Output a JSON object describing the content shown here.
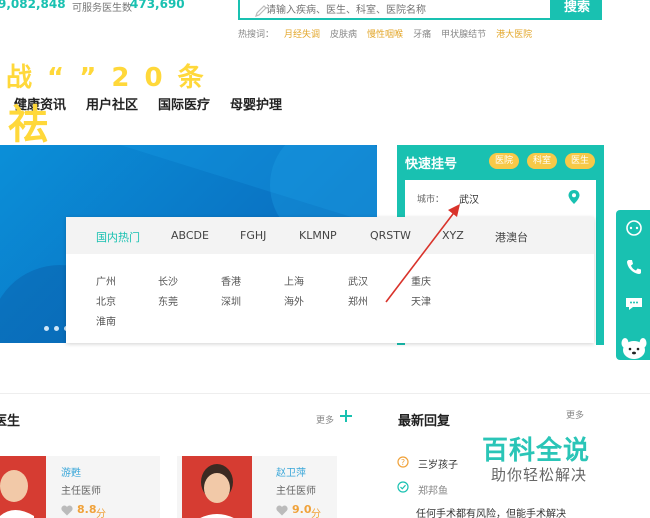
{
  "stats": {
    "visits_num": "9,082,848",
    "doctors_label": "可服务医生数",
    "doctors_num": "473,690"
  },
  "search": {
    "placeholder": "请输入疾病、医生、科室、医院名称",
    "button": "搜索",
    "hot_label": "热搜词：",
    "hot_words": [
      "月经失调",
      "皮肤病",
      "慢性咽喉",
      "牙痛",
      "甲状腺结节",
      "港大医院"
    ]
  },
  "nav": {
    "items": [
      "健康资讯",
      "用户社区",
      "国际医疗",
      "母婴护理"
    ]
  },
  "banner": {
    "text_top": "战 “ ” 2 0 条",
    "text_big": "祛"
  },
  "quick": {
    "title": "快速挂号",
    "tags": [
      "医院",
      "科室",
      "医生"
    ],
    "city_label": "城市：",
    "city_value": "武汉"
  },
  "dropdown": {
    "tabs": [
      "国内热门",
      "ABCDE",
      "FGHJ",
      "KLMNP",
      "QRSTW",
      "XYZ",
      "港澳台"
    ],
    "cities": [
      [
        "广州",
        "长沙",
        "香港",
        "上海",
        "武汉",
        "重庆"
      ],
      [
        "北京",
        "东莞",
        "深圳",
        "海外",
        "郑州",
        "天津"
      ],
      [
        "淮南"
      ]
    ]
  },
  "doctors": {
    "title": "医生",
    "more": "更多",
    "cards": [
      {
        "name": "游甦",
        "title": "主任医师",
        "score": "8.8",
        "unit": "分"
      },
      {
        "name": "赵卫萍",
        "title": "主任医师",
        "score": "9.0",
        "unit": "分"
      }
    ]
  },
  "replies": {
    "title": "最新回复",
    "more": "更多",
    "items": [
      {
        "q": "三岁孩子",
        "who": ""
      },
      {
        "q": "",
        "who": "郑邦鱼"
      },
      {
        "q": "任何手术都有风险，但能手术解决",
        "who": ""
      }
    ]
  },
  "watermark": {
    "line1": "百科全说",
    "line2": "助你轻松解决"
  },
  "colors": {
    "accent": "#19c1b1",
    "gold": "#f7c948",
    "banner": "#0a74c4"
  }
}
